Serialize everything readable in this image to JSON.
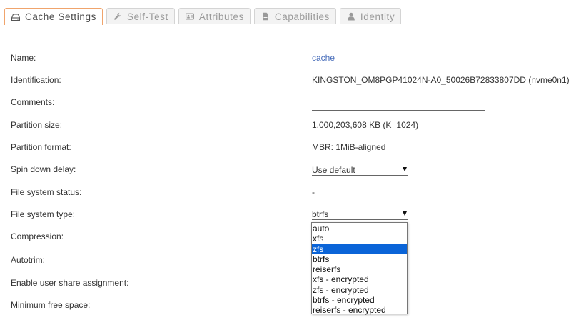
{
  "tabs": [
    {
      "label": "Cache Settings",
      "icon": "hard-drive-icon",
      "active": true
    },
    {
      "label": "Self-Test",
      "icon": "wrench-icon",
      "active": false
    },
    {
      "label": "Attributes",
      "icon": "id-card-icon",
      "active": false
    },
    {
      "label": "Capabilities",
      "icon": "file-icon",
      "active": false
    },
    {
      "label": "Identity",
      "icon": "user-icon",
      "active": false
    }
  ],
  "form": {
    "name_label": "Name:",
    "name_value": "cache",
    "identification_label": "Identification:",
    "identification_value": "KINGSTON_OM8PGP41024N-A0_50026B72833807DD (nvme0n1)",
    "comments_label": "Comments:",
    "comments_value": "",
    "partition_size_label": "Partition size:",
    "partition_size_value": "1,000,203,608 KB (K=1024)",
    "partition_format_label": "Partition format:",
    "partition_format_value": "MBR: 1MiB-aligned",
    "spin_down_label": "Spin down delay:",
    "spin_down_value": "Use default",
    "fs_status_label": "File system status:",
    "fs_status_value": "-",
    "fs_type_label": "File system type:",
    "fs_type_value": "btrfs",
    "compression_label": "Compression:",
    "autotrim_label": "Autotrim:",
    "user_share_label": "Enable user share assignment:",
    "min_free_label": "Minimum free space:"
  },
  "fs_type_dropdown": {
    "highlighted": "zfs",
    "options": [
      "auto",
      "xfs",
      "zfs",
      "btrfs",
      "reiserfs",
      "xfs - encrypted",
      "zfs - encrypted",
      "btrfs - encrypted",
      "reiserfs - encrypted"
    ]
  },
  "colors": {
    "active_tab_border": "#f0a46c",
    "link": "#486dba",
    "selection": "#0a64d8"
  }
}
